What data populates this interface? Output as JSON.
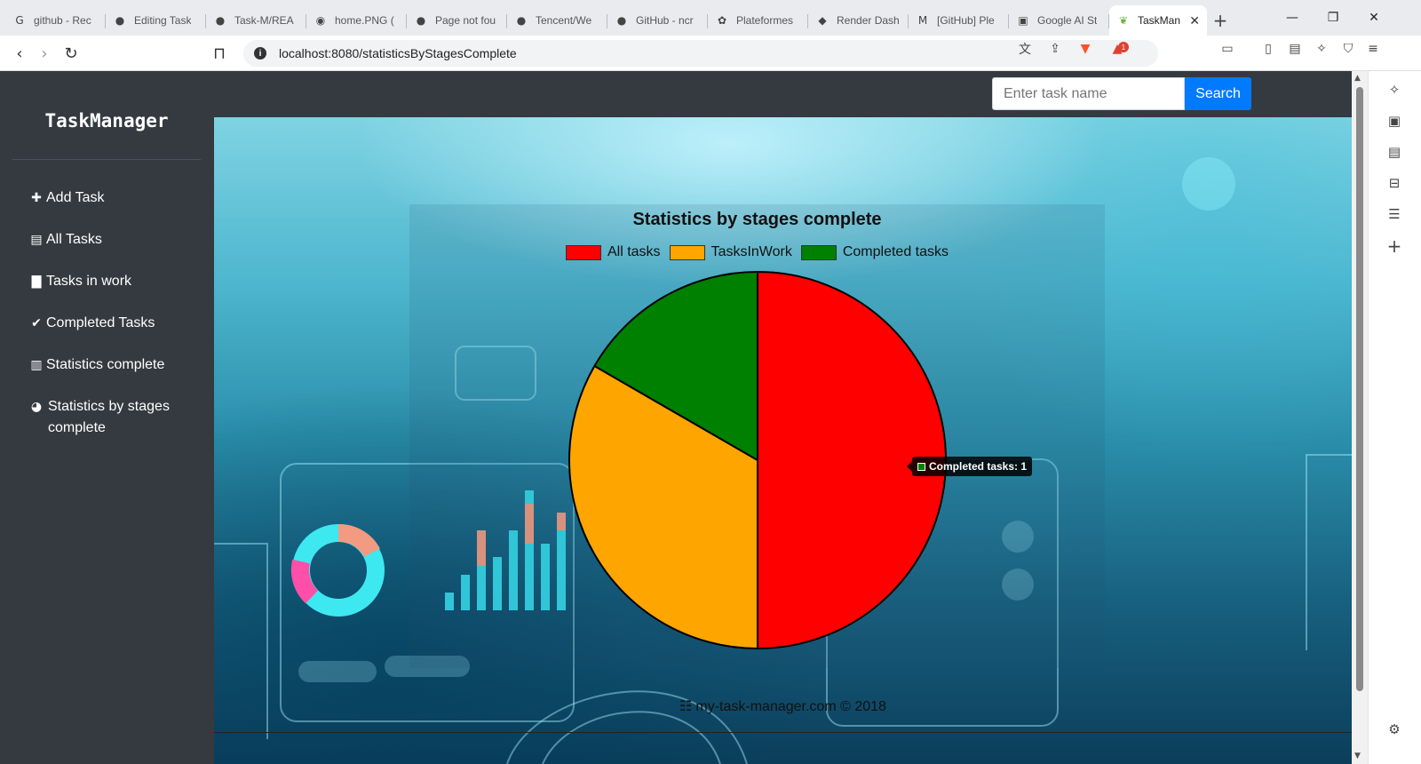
{
  "browser": {
    "tabs": [
      {
        "label": "github - Rec",
        "icon": "G"
      },
      {
        "label": "Editing Task",
        "icon": "●"
      },
      {
        "label": "Task-M/REA",
        "icon": "●"
      },
      {
        "label": "home.PNG (",
        "icon": "◉"
      },
      {
        "label": "Page not fou",
        "icon": "●"
      },
      {
        "label": "Tencent/We",
        "icon": "●"
      },
      {
        "label": "GitHub - ncr",
        "icon": "●"
      },
      {
        "label": "Plateformes",
        "icon": "✿"
      },
      {
        "label": "Render Dash",
        "icon": "◆"
      },
      {
        "label": "[GitHub] Ple",
        "icon": "M"
      },
      {
        "label": "Google AI St",
        "icon": "▣"
      },
      {
        "label": "TaskMan",
        "icon": "❦"
      }
    ],
    "active_tab_close": "✕",
    "new_tab": "+",
    "url": "localhost:8080/statisticsByStagesComplete",
    "notification_count": "1"
  },
  "sidebar": {
    "brand": "TaskManager",
    "items": [
      {
        "label": "Add Task",
        "icon": "✚"
      },
      {
        "label": "All Tasks",
        "icon": "▤"
      },
      {
        "label": "Tasks in work",
        "icon": "▇"
      },
      {
        "label": "Completed Tasks",
        "icon": "✔"
      },
      {
        "label": "Statistics complete",
        "icon": "▥"
      },
      {
        "label": "Statistics by stages complete",
        "icon": "◕"
      }
    ]
  },
  "search": {
    "placeholder": "Enter task name",
    "button_label": "Search"
  },
  "chart_data": {
    "type": "pie",
    "title": "Statistics by stages complete",
    "labels": [
      "All tasks",
      "TasksInWork",
      "Completed tasks"
    ],
    "values": [
      3,
      2,
      1
    ],
    "colors": [
      "#ff0000",
      "#ffa500",
      "#008000"
    ],
    "legend": "top",
    "tooltip": "Completed tasks: 1"
  },
  "footer": {
    "text": "my-task-manager.com © 2018"
  }
}
